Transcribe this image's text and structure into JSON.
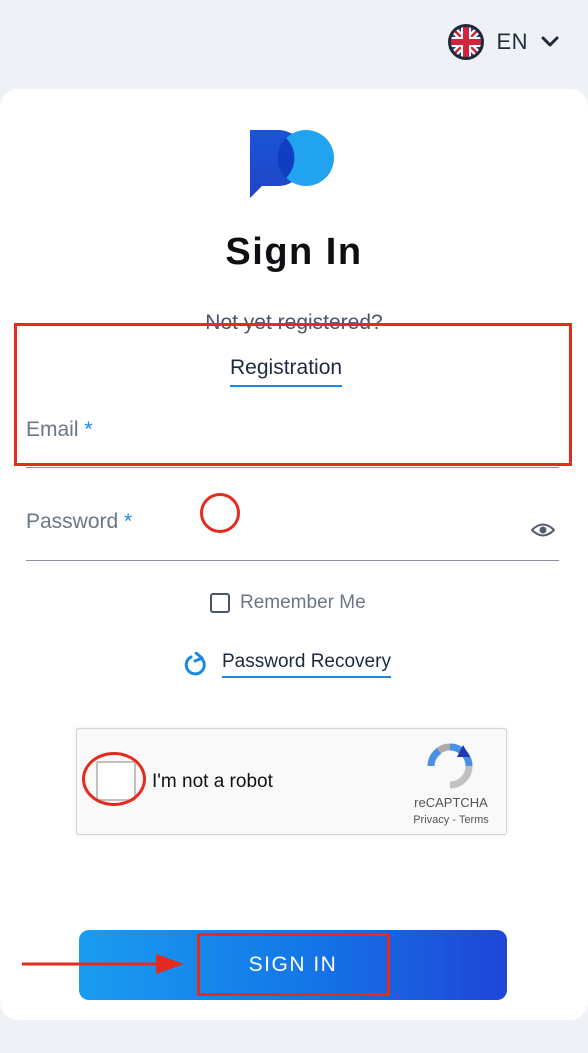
{
  "language": {
    "code": "EN",
    "icon": "uk-flag-icon"
  },
  "card": {
    "title": "Sign In",
    "subtitle": "Not yet registered?",
    "registration_link": "Registration"
  },
  "form": {
    "email": {
      "label": "Email",
      "required_mark": "*",
      "value": ""
    },
    "password": {
      "label": "Password",
      "required_mark": "*",
      "value": ""
    },
    "remember_me": {
      "label": "Remember Me",
      "checked": false
    },
    "password_recovery": "Password Recovery"
  },
  "captcha": {
    "label": "I'm not a robot",
    "brand": "reCAPTCHA",
    "privacy": "Privacy",
    "separator": "-",
    "terms": "Terms",
    "checked": false
  },
  "submit_label": "SIGN IN",
  "colors": {
    "accent": "#1a88e6",
    "annotation": "#e52b1e",
    "button_start": "#1a9cf0",
    "button_end": "#1e46d8",
    "background": "#eef2f7"
  }
}
